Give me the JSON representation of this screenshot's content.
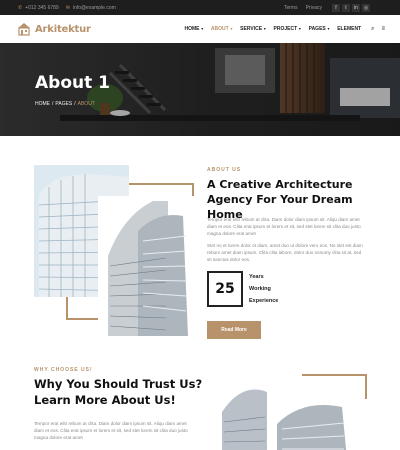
{
  "topbar": {
    "phone": "+012 345 6789",
    "email": "info@example.com",
    "links": [
      "Terms",
      "Privacy"
    ],
    "social_icons": [
      "facebook-icon",
      "twitter-icon",
      "linkedin-icon",
      "instagram-icon"
    ]
  },
  "brand": {
    "name": "Arkitektur",
    "accent": "#b8926a"
  },
  "nav": {
    "items": [
      {
        "label": "HOME",
        "dropdown": true
      },
      {
        "label": "ABOUT",
        "dropdown": true,
        "active": true
      },
      {
        "label": "SERVICE",
        "dropdown": true
      },
      {
        "label": "PROJECT",
        "dropdown": true
      },
      {
        "label": "PAGES",
        "dropdown": true
      },
      {
        "label": "ELEMENT",
        "dropdown": false
      }
    ],
    "icons": [
      "search-icon",
      "menu-icon"
    ]
  },
  "hero": {
    "title": "About 1",
    "breadcrumb": [
      "HOME",
      "PAGES",
      "ABOUT"
    ]
  },
  "about": {
    "eyebrow": "ABOUT US",
    "title": "A Creative Architecture Agency For Your Dream Home",
    "p1": "Tempor erat elitr rebum at clita. Diam dolor diam ipsum sit. Aliqu diam amet diam et eos. Clita erat ipsum et lorem et sit, sed stet lorem sit clita duo justo magna dolore erat amet",
    "p2": "Stet no et lorem dolor et diam, amet duo ut dolore vero eos. No stet est diam rebum amet diam ipsum. Clita clita labore, dolor duo nonumy clita sit at, sed sit sanctus dolor eos.",
    "years_value": "25",
    "years_label": [
      "Years",
      "Working",
      "Experience"
    ],
    "button": "Read More"
  },
  "why": {
    "eyebrow": "WHY CHOOSE US!",
    "title": "Why You Should Trust Us? Learn More About Us!",
    "p": "Tempor erat elitr rebum at clita. Diam dolor diam ipsum sit. Aliqu diam amet diam et eos. Clita erat ipsum et lorem et sit, sed stet lorem sit clita duo justo magna dolore erat amet"
  }
}
